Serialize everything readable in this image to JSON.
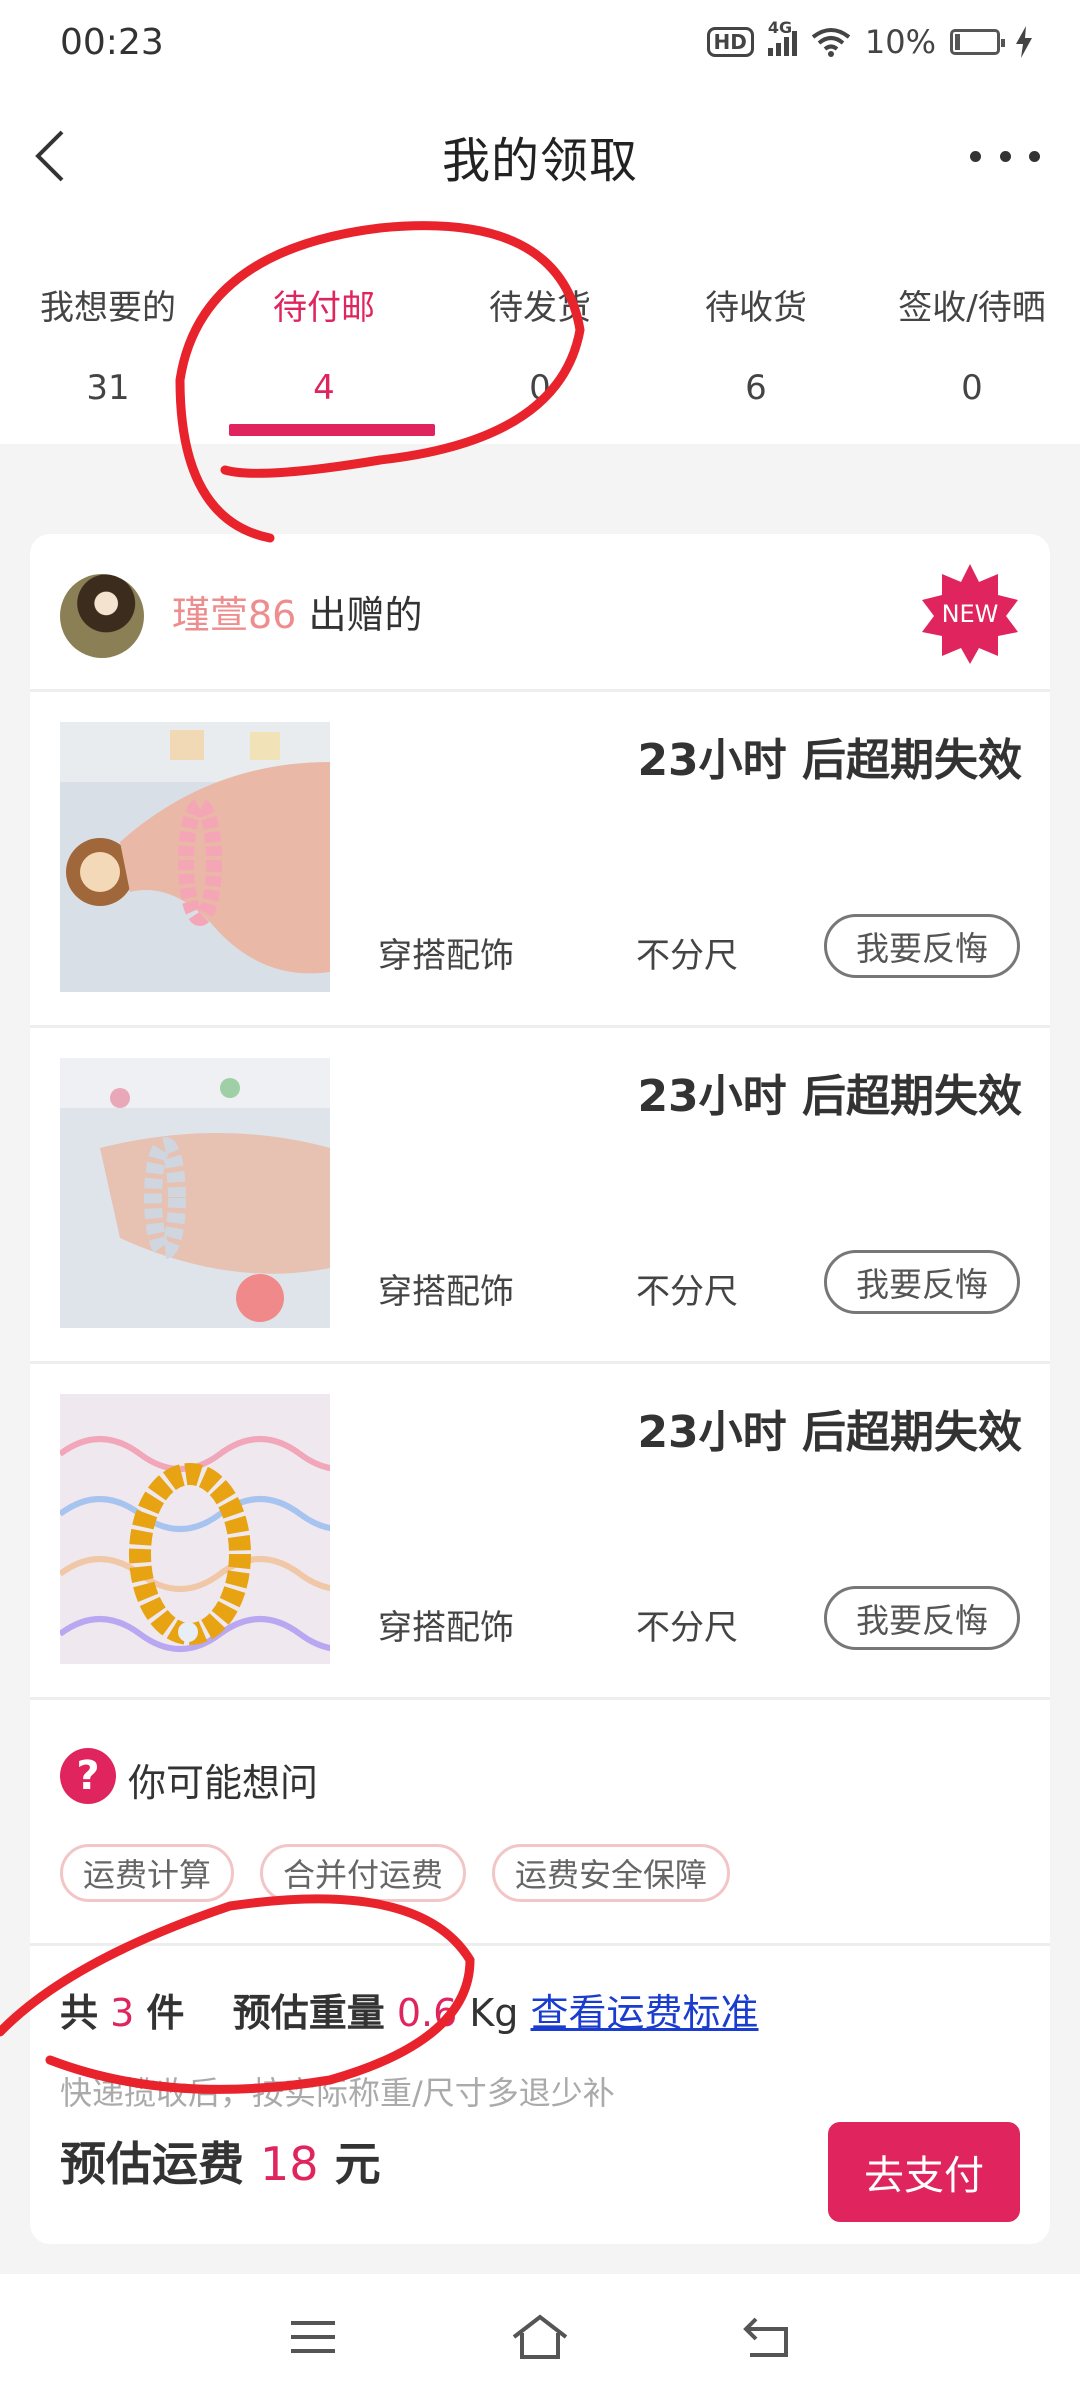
{
  "status_bar": {
    "time": "00:23",
    "hd": "HD",
    "network": "4G",
    "battery": "10%"
  },
  "nav": {
    "title": "我的领取"
  },
  "tabs": [
    {
      "label": "我想要的",
      "count": "31"
    },
    {
      "label": "待付邮",
      "count": "4",
      "active": true
    },
    {
      "label": "待发货",
      "count": "0"
    },
    {
      "label": "待收货",
      "count": "6"
    },
    {
      "label": "签收/待晒",
      "count": "0"
    }
  ],
  "giver": {
    "name": "瑾萱86",
    "suffix": " 出赠的",
    "badge": "NEW"
  },
  "items": [
    {
      "expiry": "23小时 后超期失效",
      "category": "穿搭配饰",
      "size": "不分尺",
      "action": "我要反悔"
    },
    {
      "expiry": "23小时 后超期失效",
      "category": "穿搭配饰",
      "size": "不分尺",
      "action": "我要反悔"
    },
    {
      "expiry": "23小时 后超期失效",
      "category": "穿搭配饰",
      "size": "不分尺",
      "action": "我要反悔"
    }
  ],
  "faq": {
    "title": "你可能想问",
    "chips": [
      "运费计算",
      "合并付运费",
      "运费安全保障"
    ]
  },
  "summary": {
    "total_prefix": "共",
    "total_count": "3",
    "total_suffix": "件",
    "weight_label": "预估重量",
    "weight_value": "0.6",
    "weight_unit": "Kg",
    "link": "查看运费标准",
    "note": "快递揽收后，按实际称重/尺寸多退少补",
    "fee_label": "预估运费",
    "fee_value": "18",
    "fee_unit": "元",
    "pay_button": "去支付"
  },
  "colors": {
    "accent": "#e0245e",
    "link": "#1a3ccf",
    "annotation": "#e8232b"
  },
  "icons": [
    "back-arrow-icon",
    "more-dots-icon",
    "question-icon",
    "menu-icon",
    "home-icon",
    "back-nav-icon"
  ]
}
